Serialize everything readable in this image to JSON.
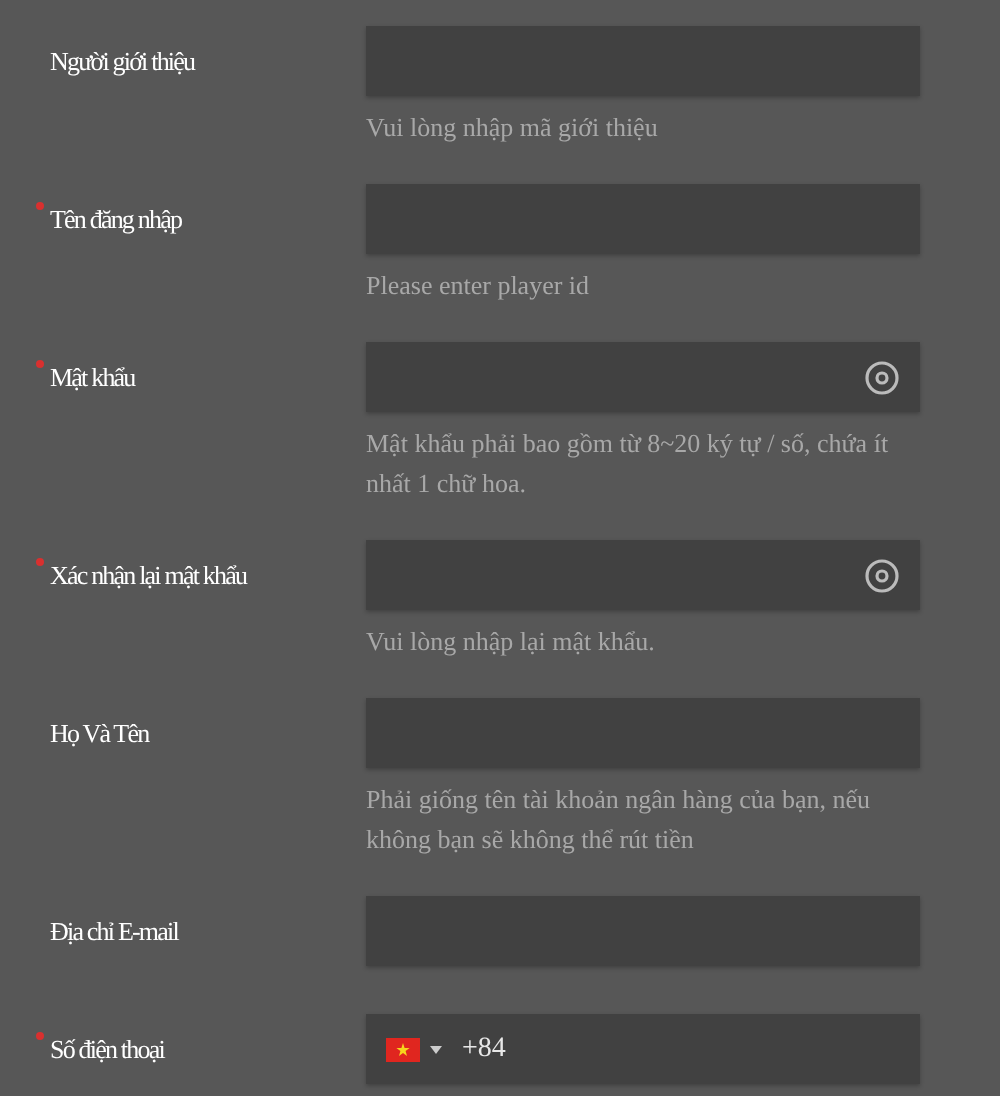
{
  "fields": [
    {
      "label": "Người giới thiệu",
      "required": false,
      "kind": "text",
      "hint": "Vui lòng nhập mã giới thiệu"
    },
    {
      "label": "Tên đăng nhập",
      "required": true,
      "kind": "text",
      "hint": "Please enter player id"
    },
    {
      "label": "Mật khẩu",
      "required": true,
      "kind": "password",
      "hint": "Mật khẩu phải bao gồm từ 8~20 ký tự / số, chứa ít nhất 1 chữ hoa."
    },
    {
      "label": "Xác nhận lại mật khẩu",
      "required": true,
      "kind": "password",
      "hint": "Vui lòng nhập lại mật khẩu."
    },
    {
      "label": "Họ Và Tên",
      "required": false,
      "kind": "text",
      "hint": "Phải giống tên tài khoản ngân hàng của bạn, nếu không bạn sẽ không thể rút tiền"
    },
    {
      "label": "Địa chỉ E-mail",
      "required": false,
      "kind": "text"
    },
    {
      "label": "Số điện thoại",
      "required": true,
      "kind": "phone",
      "country_code": "+84"
    }
  ]
}
